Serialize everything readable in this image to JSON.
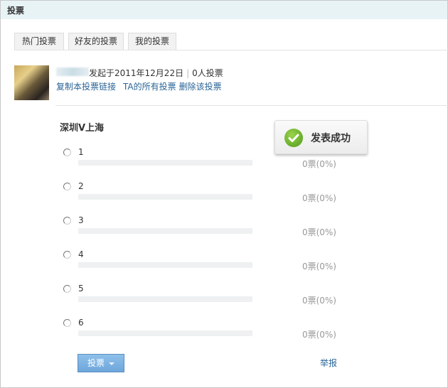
{
  "header": {
    "title": "投票"
  },
  "tabs": [
    {
      "label": "热门投票"
    },
    {
      "label": "好友的投票"
    },
    {
      "label": "我的投票"
    }
  ],
  "poll": {
    "meta": "发起于2011年12月22日",
    "voters": "0人投票",
    "links": {
      "copy": "复制本投票链接",
      "all": "TA的所有投票",
      "delete": "删除该投票"
    },
    "title": "深圳V上海",
    "options": [
      {
        "label": "1",
        "count": "0票(0%)",
        "percent": 0
      },
      {
        "label": "2",
        "count": "0票(0%)",
        "percent": 0
      },
      {
        "label": "3",
        "count": "0票(0%)",
        "percent": 0
      },
      {
        "label": "4",
        "count": "0票(0%)",
        "percent": 0
      },
      {
        "label": "5",
        "count": "0票(0%)",
        "percent": 0
      },
      {
        "label": "6",
        "count": "0票(0%)",
        "percent": 0
      }
    ],
    "vote_label": "投票",
    "report_label": "举报"
  },
  "toast": {
    "text": "发表成功"
  }
}
